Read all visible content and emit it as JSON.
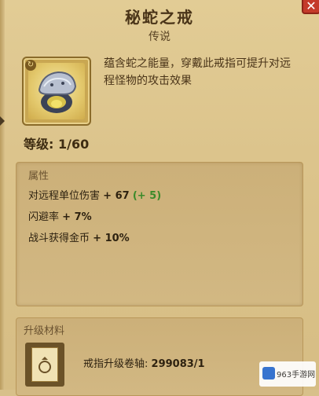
{
  "header": {
    "title": "秘蛇之戒",
    "rarity": "传说",
    "close_symbol": "✕"
  },
  "item": {
    "icon": "serpent-ring-icon",
    "cycle_badge": "↻",
    "description": "蕴含蛇之能量，穿戴此戒指可提升对远程怪物的攻击效果",
    "level_label": "等级: 1/60"
  },
  "attributes": {
    "section_title": "属性",
    "rows": [
      {
        "label": "对远程单位伤害",
        "value": "+ 67",
        "bonus": "(+ 5)"
      },
      {
        "label": "闪避率",
        "value": "+ 7%",
        "bonus": ""
      },
      {
        "label": "战斗获得金币",
        "value": "+ 10%",
        "bonus": ""
      }
    ]
  },
  "materials": {
    "section_title": "升级材料",
    "icon": "scroll-icon",
    "label": "戒指升级卷轴:",
    "count": "299083/1"
  },
  "watermark": {
    "text": "963手游网"
  },
  "colors": {
    "panel_bg": "#dcc48c",
    "close_button": "#c43a2a",
    "bonus_green": "#3a8a2a",
    "text_dark": "#4a3418"
  }
}
